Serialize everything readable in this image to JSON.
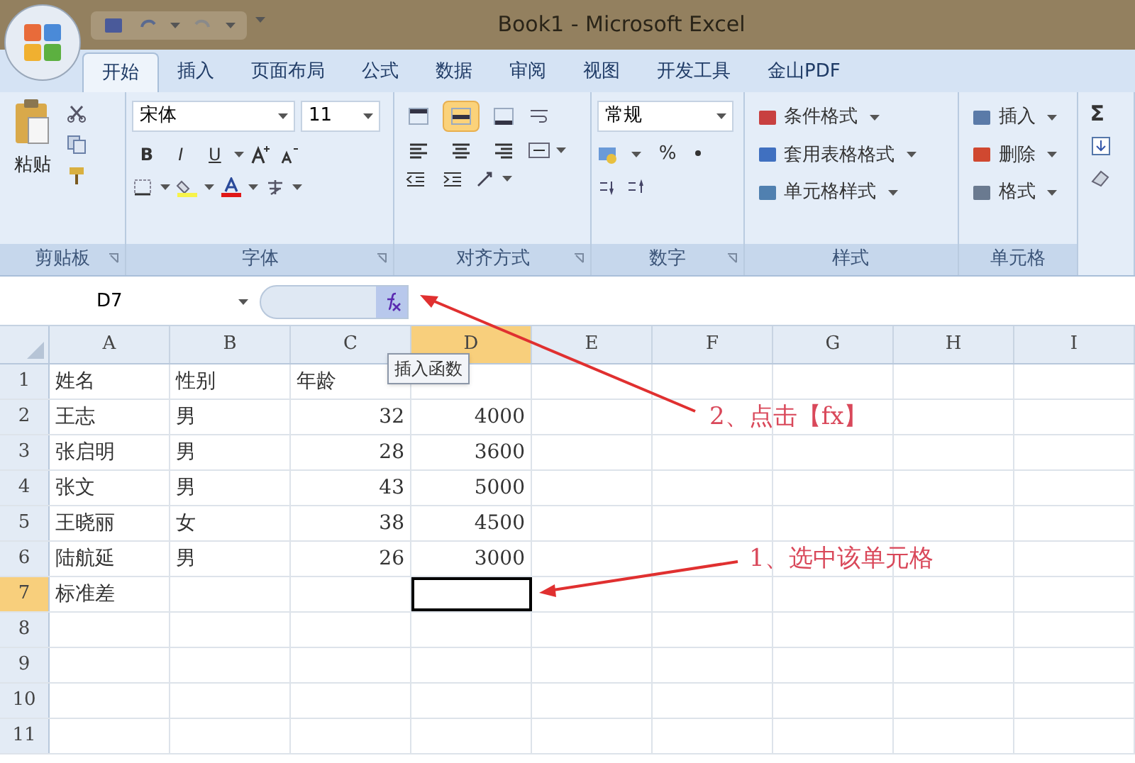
{
  "window": {
    "title": "Book1 - Microsoft Excel"
  },
  "tabs": [
    {
      "label": "开始",
      "selected": true
    },
    {
      "label": "插入",
      "selected": false
    },
    {
      "label": "页面布局",
      "selected": false
    },
    {
      "label": "公式",
      "selected": false
    },
    {
      "label": "数据",
      "selected": false
    },
    {
      "label": "审阅",
      "selected": false
    },
    {
      "label": "视图",
      "selected": false
    },
    {
      "label": "开发工具",
      "selected": false
    },
    {
      "label": "金山PDF",
      "selected": false
    }
  ],
  "ribbon": {
    "groups": [
      {
        "kind": "clipboard",
        "label": "剪贴板",
        "launcher": true,
        "paste": "粘贴"
      },
      {
        "kind": "font",
        "label": "字体",
        "launcher": true,
        "font": "宋体",
        "size": "11",
        "styles": [
          "B",
          "I",
          "U"
        ]
      },
      {
        "kind": "align",
        "label": "对齐方式",
        "launcher": true,
        "vertical": [
          {
            "selected": false
          },
          {
            "selected": true
          },
          {
            "selected": false
          }
        ]
      },
      {
        "kind": "number",
        "label": "数字",
        "launcher": true,
        "format": "常规",
        "symbol": "%"
      },
      {
        "kind": "styles",
        "label": "样式",
        "items": [
          "条件格式",
          "套用表格格式",
          "单元格样式"
        ]
      },
      {
        "kind": "cells",
        "label": "单元格",
        "items": [
          "插入",
          "删除",
          "格式"
        ]
      },
      {
        "kind": "editing",
        "symbol": "Σ"
      }
    ]
  },
  "formula_bar": {
    "name_box": "D7",
    "tooltip": "插入函数"
  },
  "grid": {
    "columns": [
      {
        "label": "A",
        "selected": false
      },
      {
        "label": "B",
        "selected": false
      },
      {
        "label": "C",
        "selected": false
      },
      {
        "label": "D",
        "selected": true
      },
      {
        "label": "E",
        "selected": false
      },
      {
        "label": "F",
        "selected": false
      },
      {
        "label": "G",
        "selected": false
      },
      {
        "label": "H",
        "selected": false
      },
      {
        "label": "I",
        "selected": false
      }
    ],
    "rows": [
      {
        "header": "1",
        "selected": false,
        "cells": [
          {
            "text": "姓名",
            "kind": "text"
          },
          {
            "text": "性别",
            "kind": "text"
          },
          {
            "text": "年龄",
            "kind": "text"
          }
        ]
      },
      {
        "header": "2",
        "selected": false,
        "cells": [
          {
            "text": "王志",
            "kind": "text"
          },
          {
            "text": "男",
            "kind": "text"
          },
          {
            "text": "32",
            "kind": "number"
          },
          {
            "text": "4000",
            "kind": "number"
          }
        ]
      },
      {
        "header": "3",
        "selected": false,
        "cells": [
          {
            "text": "张启明",
            "kind": "text"
          },
          {
            "text": "男",
            "kind": "text"
          },
          {
            "text": "28",
            "kind": "number"
          },
          {
            "text": "3600",
            "kind": "number"
          }
        ]
      },
      {
        "header": "4",
        "selected": false,
        "cells": [
          {
            "text": "张文",
            "kind": "text"
          },
          {
            "text": "男",
            "kind": "text"
          },
          {
            "text": "43",
            "kind": "number"
          },
          {
            "text": "5000",
            "kind": "number"
          }
        ]
      },
      {
        "header": "5",
        "selected": false,
        "cells": [
          {
            "text": "王晓丽",
            "kind": "text"
          },
          {
            "text": "女",
            "kind": "text"
          },
          {
            "text": "38",
            "kind": "number"
          },
          {
            "text": "4500",
            "kind": "number"
          }
        ]
      },
      {
        "header": "6",
        "selected": false,
        "cells": [
          {
            "text": "陆航延",
            "kind": "text"
          },
          {
            "text": "男",
            "kind": "text"
          },
          {
            "text": "26",
            "kind": "number"
          },
          {
            "text": "3000",
            "kind": "number"
          }
        ]
      },
      {
        "header": "7",
        "selected": true,
        "cells": [
          {
            "text": "标准差",
            "kind": "text"
          }
        ]
      },
      {
        "header": "8",
        "selected": false
      },
      {
        "header": "9",
        "selected": false
      },
      {
        "header": "10",
        "selected": false
      },
      {
        "header": "11",
        "selected": false
      }
    ]
  },
  "annotations": [
    {
      "text": "2、点击【fx】"
    },
    {
      "text": "1、选中该单元格"
    }
  ]
}
